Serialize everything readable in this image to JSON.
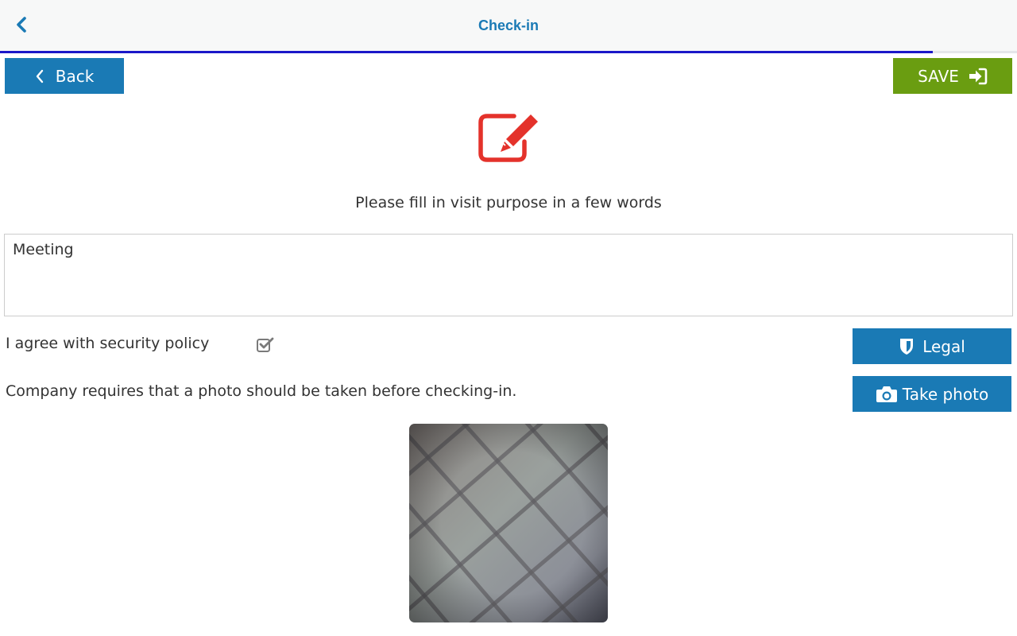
{
  "appbar": {
    "title": "Check-in",
    "back_icon": "chevron-left-icon"
  },
  "progress": {
    "fraction": 0.917,
    "color": "#1a17c8"
  },
  "toolbar": {
    "back_label": "Back",
    "back_icon": "chevron-left-icon",
    "save_label": "SAVE",
    "save_icon": "sign-in-icon"
  },
  "form": {
    "header_icon": "edit-icon",
    "prompt": "Please fill in visit purpose in a few words",
    "purpose_value": "Meeting",
    "agree_label": "I agree with security policy",
    "agree_checked": true,
    "legal_label": "Legal",
    "legal_icon": "shield-icon",
    "photo_note": "Company requires that a photo should be taken before checking-in.",
    "take_photo_label": "Take photo",
    "take_photo_icon": "camera-icon"
  },
  "colors": {
    "primary": "#1a7ab5",
    "save": "#6a9d11",
    "accent_red": "#e4322b",
    "title": "#1a7ab5"
  }
}
